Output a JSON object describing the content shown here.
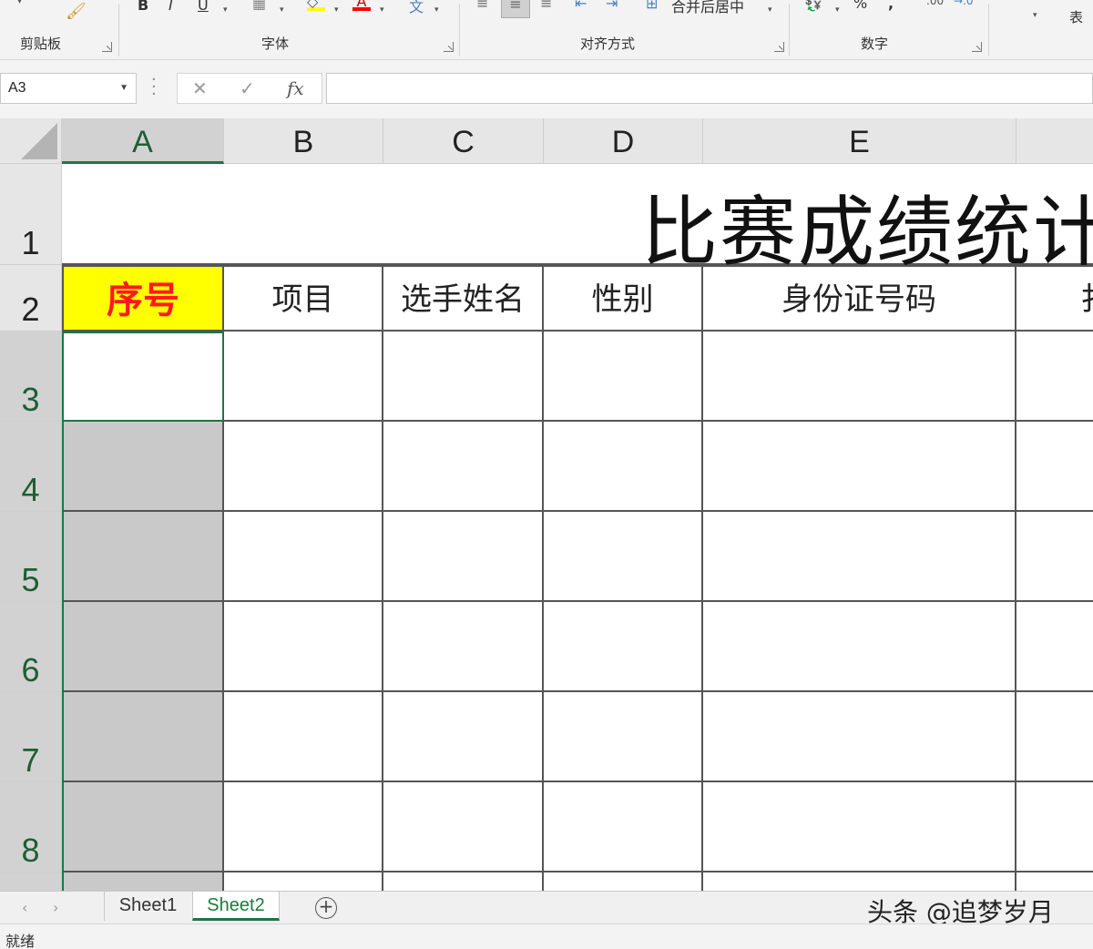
{
  "ribbon": {
    "clipboard_label": "剪贴板",
    "font_label": "字体",
    "alignment_label": "对齐方式",
    "number_label": "数字",
    "merge_center_label": "合并后居中",
    "percent_symbol": "%",
    "comma_symbol": ",",
    "bold": "B",
    "italic": "I",
    "underline": "U",
    "font_color_letter": "A",
    "partial_right_label": "表"
  },
  "formula_bar": {
    "name_box": "A3",
    "cancel_symbol": "✕",
    "enter_symbol": "✓",
    "fx_symbol": "fx",
    "formula_value": ""
  },
  "grid": {
    "columns": [
      "A",
      "B",
      "C",
      "D",
      "E"
    ],
    "rows": [
      "1",
      "2",
      "3",
      "4",
      "5",
      "6",
      "7",
      "8"
    ],
    "title": "比赛成绩统计",
    "headers": [
      "序号",
      "项目",
      "选手姓名",
      "性别",
      "身份证号码",
      "扌"
    ]
  },
  "sheets": {
    "tabs": [
      "Sheet1",
      "Sheet2"
    ],
    "active": "Sheet2"
  },
  "watermark": "头条 @追梦岁月",
  "status": {
    "text": "就绪"
  },
  "colors": {
    "accent": "#217346",
    "header_fill": "#ffff00",
    "header_text": "#ff1a1a",
    "shaded_cell": "#c9c9c9"
  }
}
